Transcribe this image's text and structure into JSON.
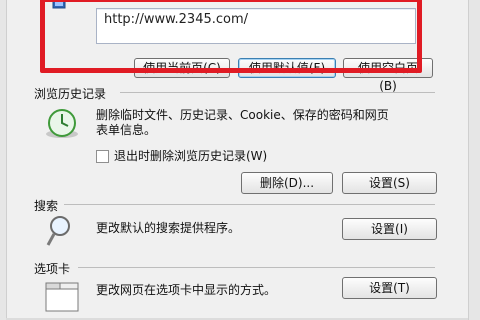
{
  "homepage": {
    "url": "http://www.2345.com/",
    "buttons": {
      "use_current": "使用当前页(C)",
      "use_default": "使用默认值(F)",
      "use_blank": "使用空白页(B)"
    }
  },
  "history": {
    "title": "浏览历史记录",
    "description_line1": "删除临时文件、历史记录、Cookie、保存的密码和网页",
    "description_line2": "表单信息。",
    "checkbox_label": "退出时删除浏览历史记录(W)",
    "checkbox_checked": false,
    "delete_button": "删除(D)...",
    "settings_button": "设置(S)"
  },
  "search": {
    "title": "搜索",
    "description": "更改默认的搜索提供程序。",
    "settings_button": "设置(I)"
  },
  "tabs": {
    "title": "选项卡",
    "description": "更改网页在选项卡中显示的方式。",
    "settings_button": "设置(T)"
  },
  "colors": {
    "highlight": "#e01b24"
  }
}
